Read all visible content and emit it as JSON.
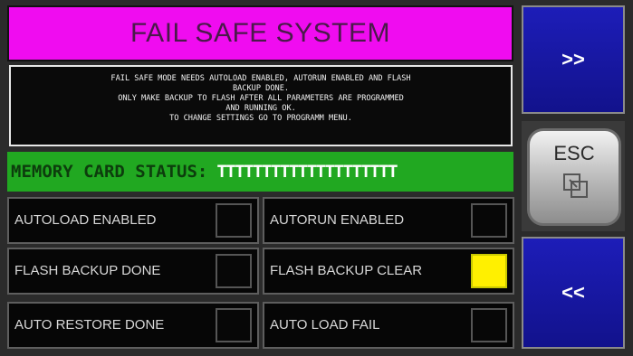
{
  "title": "FAIL SAFE SYSTEM",
  "message_lines": [
    "FAIL SAFE MODE NEEDS AUTOLOAD ENABLED, AUTORUN ENABLED AND FLASH",
    "BACKUP DONE.",
    "ONLY MAKE BACKUP TO FLASH AFTER ALL PARAMETERS ARE PROGRAMMED",
    "AND RUNNING OK.",
    "TO CHANGE SETTINGS GO TO PROGRAMM MENU."
  ],
  "memory_card": {
    "label": "MEMORY CARD STATUS:",
    "value": "TTTTTTTTTTTTTTTTTTTT"
  },
  "indicators": [
    {
      "label": "AUTOLOAD ENABLED",
      "state": "off"
    },
    {
      "label": "AUTORUN ENABLED",
      "state": "off"
    },
    {
      "label": "FLASH BACKUP DONE",
      "state": "off"
    },
    {
      "label": "FLASH BACKUP CLEAR",
      "state": "on"
    },
    {
      "label": "AUTO RESTORE DONE",
      "state": "off"
    },
    {
      "label": "AUTO LOAD FAIL",
      "state": "off"
    }
  ],
  "nav": {
    "next_label": ">>",
    "esc_label": "ESC",
    "prev_label": "<<"
  },
  "colors": {
    "title_bg": "#f00cf0",
    "status_bg": "#21a821",
    "lamp_on": "#fff000",
    "nav_bg": "#1a1aa8"
  },
  "icons": {
    "esc": "window-restore-icon"
  }
}
